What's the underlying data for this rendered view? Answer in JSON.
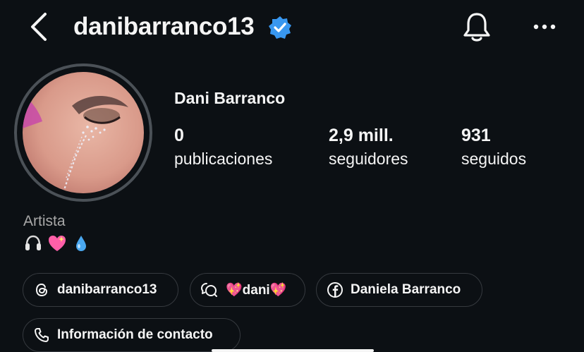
{
  "header": {
    "username": "danibarranco13",
    "icons": {
      "back": "chevron-left-icon",
      "verified": "verified-badge-icon",
      "bell": "bell-icon",
      "more": "more-horizontal-icon"
    },
    "accent": "#3897f0"
  },
  "profile": {
    "full_name": "Dani Barranco",
    "stats": [
      {
        "value": "0",
        "label": "publicaciones"
      },
      {
        "value": "2,9 mill.",
        "label": "seguidores"
      },
      {
        "value": "931",
        "label": "seguidos"
      }
    ],
    "category": "Artista",
    "bio_emojis": [
      "headphones",
      "sparkling-heart",
      "droplet"
    ]
  },
  "links": [
    {
      "label": "danibarranco13",
      "icon": "threads-icon"
    },
    {
      "label": "💖dani💖",
      "icon": "chat-bubbles-icon"
    },
    {
      "label": "Daniela Barranco",
      "icon": "facebook-icon"
    },
    {
      "label": "Información de contacto",
      "icon": "phone-icon"
    }
  ]
}
